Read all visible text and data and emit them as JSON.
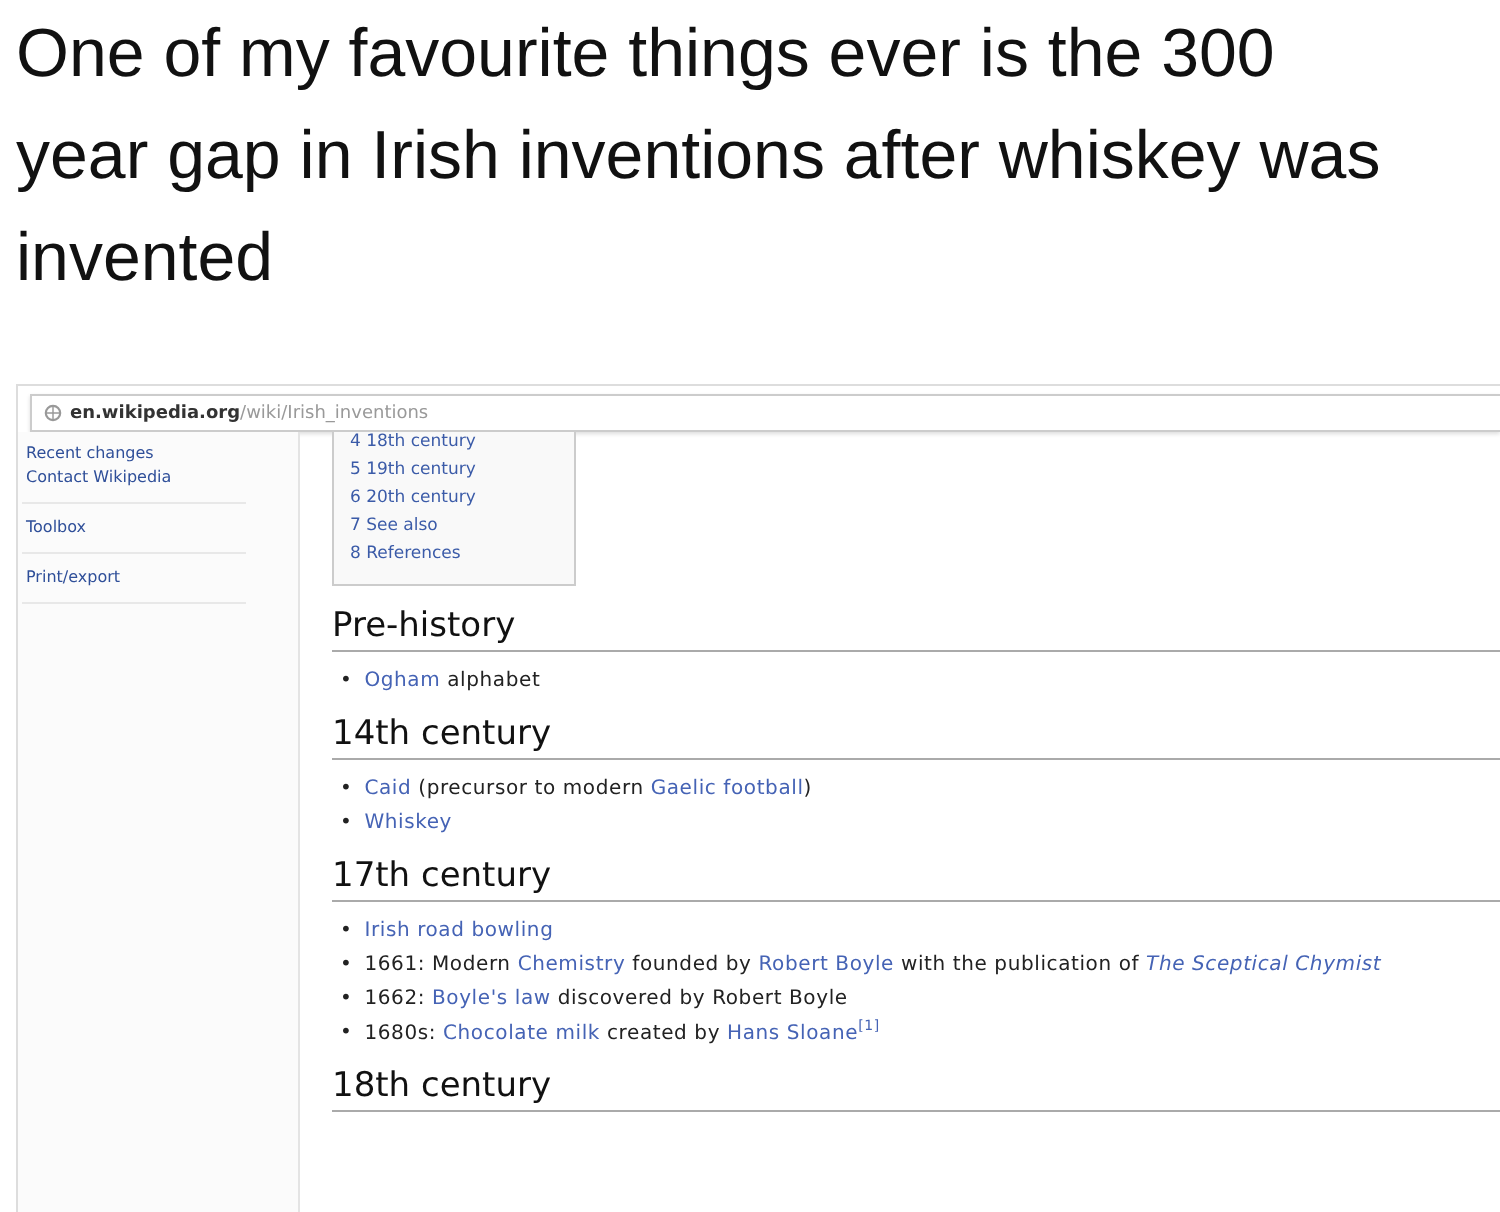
{
  "caption": "One of my favourite things ever is the 300 year gap in Irish inventions after whiskey was invented",
  "browser": {
    "address": {
      "domain": "en.wikipedia.org",
      "path": "/wiki/Irish_inventions"
    }
  },
  "sidebar": {
    "groups": [
      [
        "Recent changes",
        "Contact Wikipedia"
      ],
      [
        "Toolbox"
      ],
      [
        "Print/export"
      ]
    ]
  },
  "toc": [
    "4 18th century",
    "5 19th century",
    "6 20th century",
    "7 See also",
    "8 References"
  ],
  "sections": [
    {
      "heading": "Pre-history",
      "items": [
        {
          "bullet": "•",
          "segments": [
            {
              "kind": "link",
              "text": "Ogham"
            },
            {
              "kind": "text",
              "text": " alphabet"
            }
          ]
        }
      ]
    },
    {
      "heading": "14th century",
      "items": [
        {
          "bullet": "•",
          "segments": [
            {
              "kind": "link",
              "text": "Caid"
            },
            {
              "kind": "text",
              "text": " (precursor to modern "
            },
            {
              "kind": "link",
              "text": "Gaelic football"
            },
            {
              "kind": "text",
              "text": ")"
            }
          ]
        },
        {
          "bullet": "•",
          "segments": [
            {
              "kind": "link",
              "text": "Whiskey"
            }
          ]
        }
      ]
    },
    {
      "heading": "17th century",
      "items": [
        {
          "bullet": "•",
          "segments": [
            {
              "kind": "link",
              "text": "Irish road bowling"
            }
          ]
        },
        {
          "bullet": "•",
          "segments": [
            {
              "kind": "text",
              "text": "1661: Modern "
            },
            {
              "kind": "link",
              "text": "Chemistry"
            },
            {
              "kind": "text",
              "text": " founded by "
            },
            {
              "kind": "link",
              "text": "Robert Boyle"
            },
            {
              "kind": "text",
              "text": " with the publication of "
            },
            {
              "kind": "link",
              "text": "*The Sceptical Chymist*"
            }
          ]
        },
        {
          "bullet": "•",
          "segments": [
            {
              "kind": "text",
              "text": "1662: "
            },
            {
              "kind": "link",
              "text": "Boyle's law"
            },
            {
              "kind": "text",
              "text": " discovered by Robert Boyle"
            }
          ]
        },
        {
          "bullet": "•",
          "segments": [
            {
              "kind": "text",
              "text": "1680s: "
            },
            {
              "kind": "link",
              "text": "Chocolate milk"
            },
            {
              "kind": "text",
              "text": " created by "
            },
            {
              "kind": "link",
              "text": "Hans Sloane"
            },
            {
              "kind": "ref",
              "text": "[1]"
            }
          ]
        }
      ]
    },
    {
      "heading": "18th century"
    }
  ]
}
